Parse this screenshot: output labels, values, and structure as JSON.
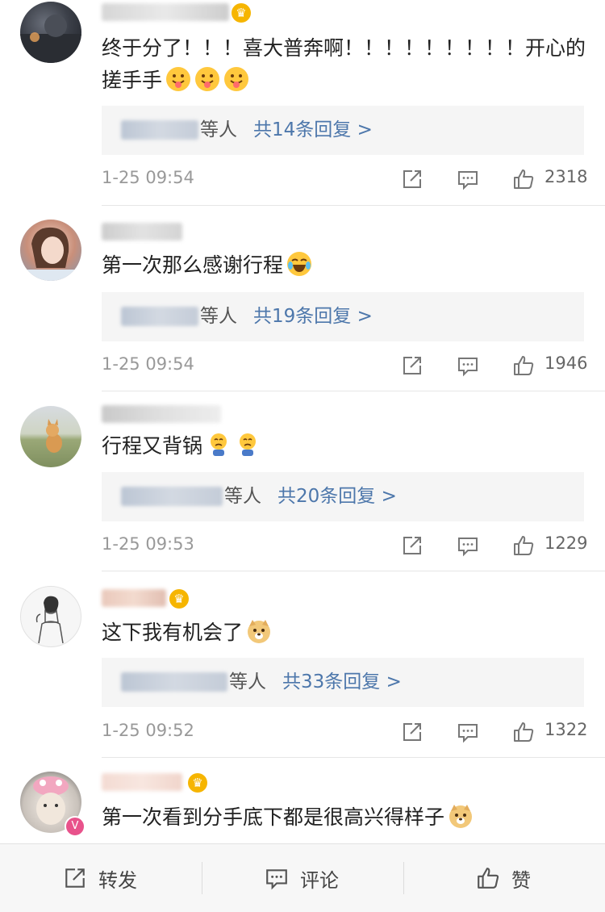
{
  "comments": [
    {
      "text": "终于分了！！！喜大普奔啊！！！！！！！！！开心的搓手手",
      "reply_suffix": "等人",
      "reply_link": "共14条回复 >",
      "time": "1-25 09:54",
      "likes": "2318"
    },
    {
      "text": "第一次那么感谢行程",
      "reply_suffix": "等人",
      "reply_link": "共19条回复 >",
      "time": "1-25 09:54",
      "likes": "1946"
    },
    {
      "text": "行程又背锅",
      "reply_suffix": "等人",
      "reply_link": "共20条回复 >",
      "time": "1-25 09:53",
      "likes": "1229"
    },
    {
      "text": "这下我有机会了",
      "reply_suffix": "等人",
      "reply_link": "共33条回复 >",
      "time": "1-25 09:52",
      "likes": "1322"
    },
    {
      "text": "第一次看到分手底下都是很高兴得样子"
    }
  ],
  "bottom_bar": {
    "repost_label": "转发",
    "comment_label": "评论",
    "like_label": "赞"
  },
  "colors": {
    "link": "#4d77ab",
    "meta_text": "#999999",
    "reply_bg": "#f5f5f5"
  }
}
